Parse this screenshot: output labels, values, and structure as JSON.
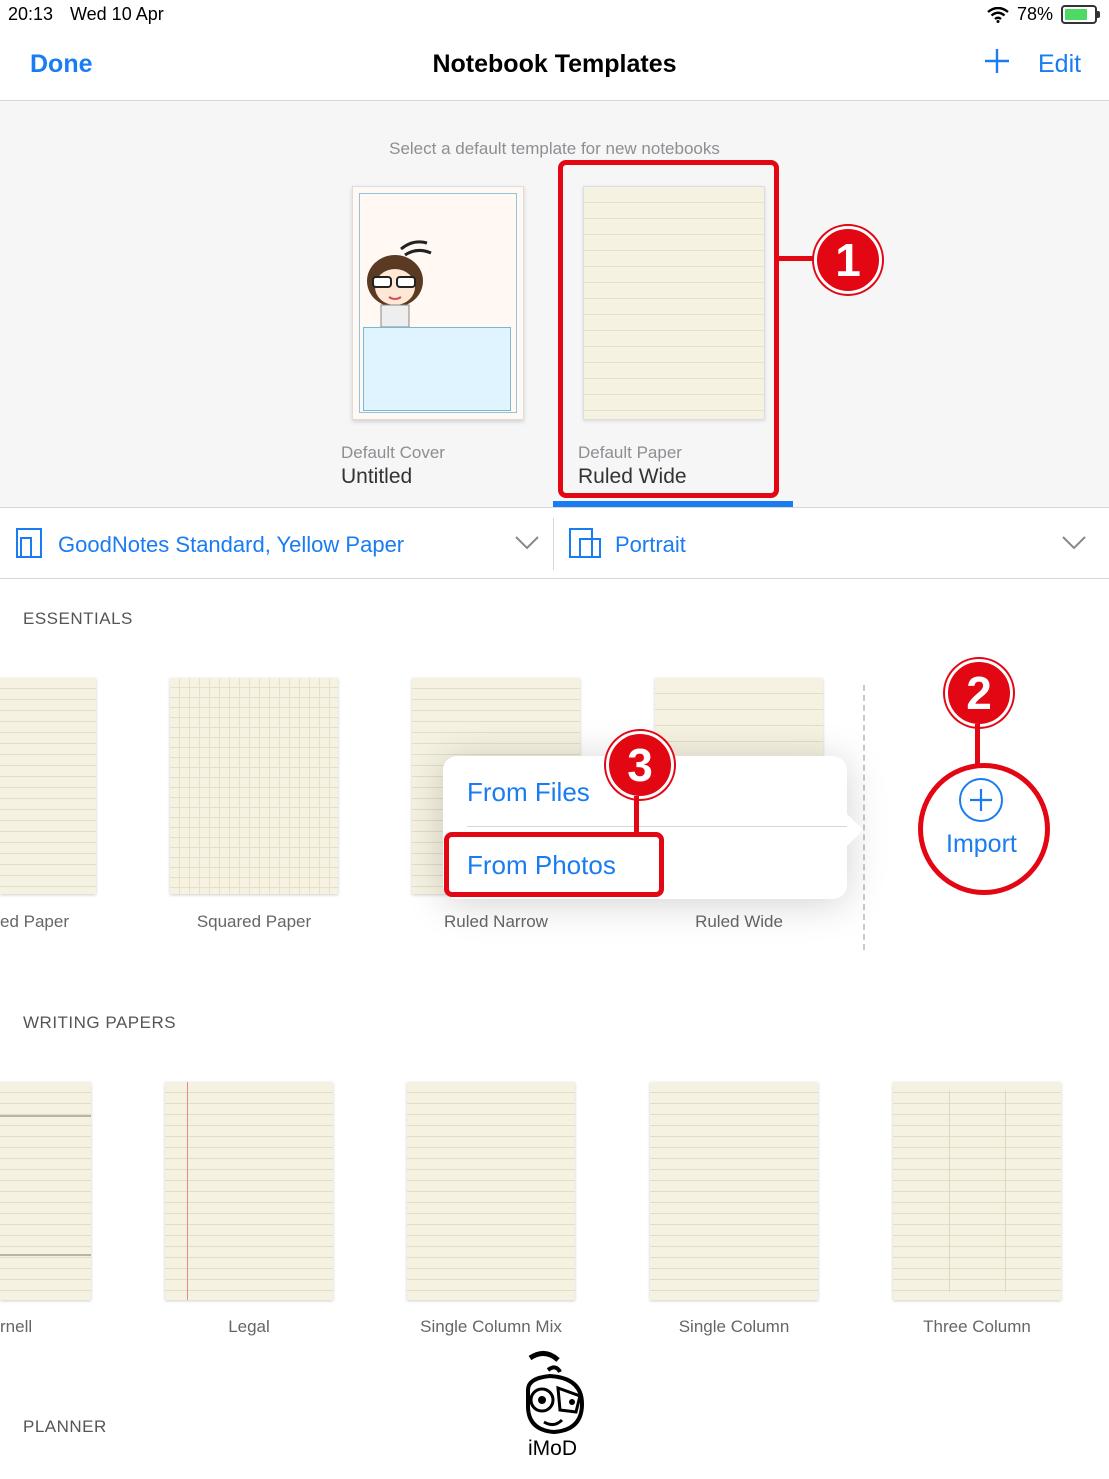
{
  "status_bar": {
    "time": "20:13",
    "date": "Wed 10 Apr",
    "battery": "78%"
  },
  "nav": {
    "done_label": "Done",
    "title": "Notebook Templates",
    "edit_label": "Edit"
  },
  "defaults": {
    "caption": "Select a default template for new notebooks",
    "cover": {
      "label": "Default Cover",
      "value": "Untitled"
    },
    "paper": {
      "label": "Default Paper",
      "value": "Ruled Wide"
    }
  },
  "picker": {
    "template_set": "GoodNotes Standard, Yellow Paper",
    "orientation": "Portrait"
  },
  "sections": {
    "essentials": {
      "title": "ESSENTIALS",
      "items": [
        "ed Paper",
        "Squared Paper",
        "Ruled Narrow",
        "Ruled Wide"
      ]
    },
    "writing": {
      "title": "WRITING PAPERS",
      "items": [
        "rnell",
        "Legal",
        "Single Column Mix",
        "Single Column",
        "Three Column"
      ]
    },
    "planner": {
      "title": "PLANNER"
    }
  },
  "import_label": "Import",
  "popover": {
    "from_files": "From Files",
    "from_photos": "From Photos"
  },
  "annotations": {
    "step1": "1",
    "step2": "2",
    "step3": "3"
  },
  "watermark": "iMoD",
  "colors": {
    "accent": "#1a7cf2",
    "annotation": "#e30613"
  }
}
